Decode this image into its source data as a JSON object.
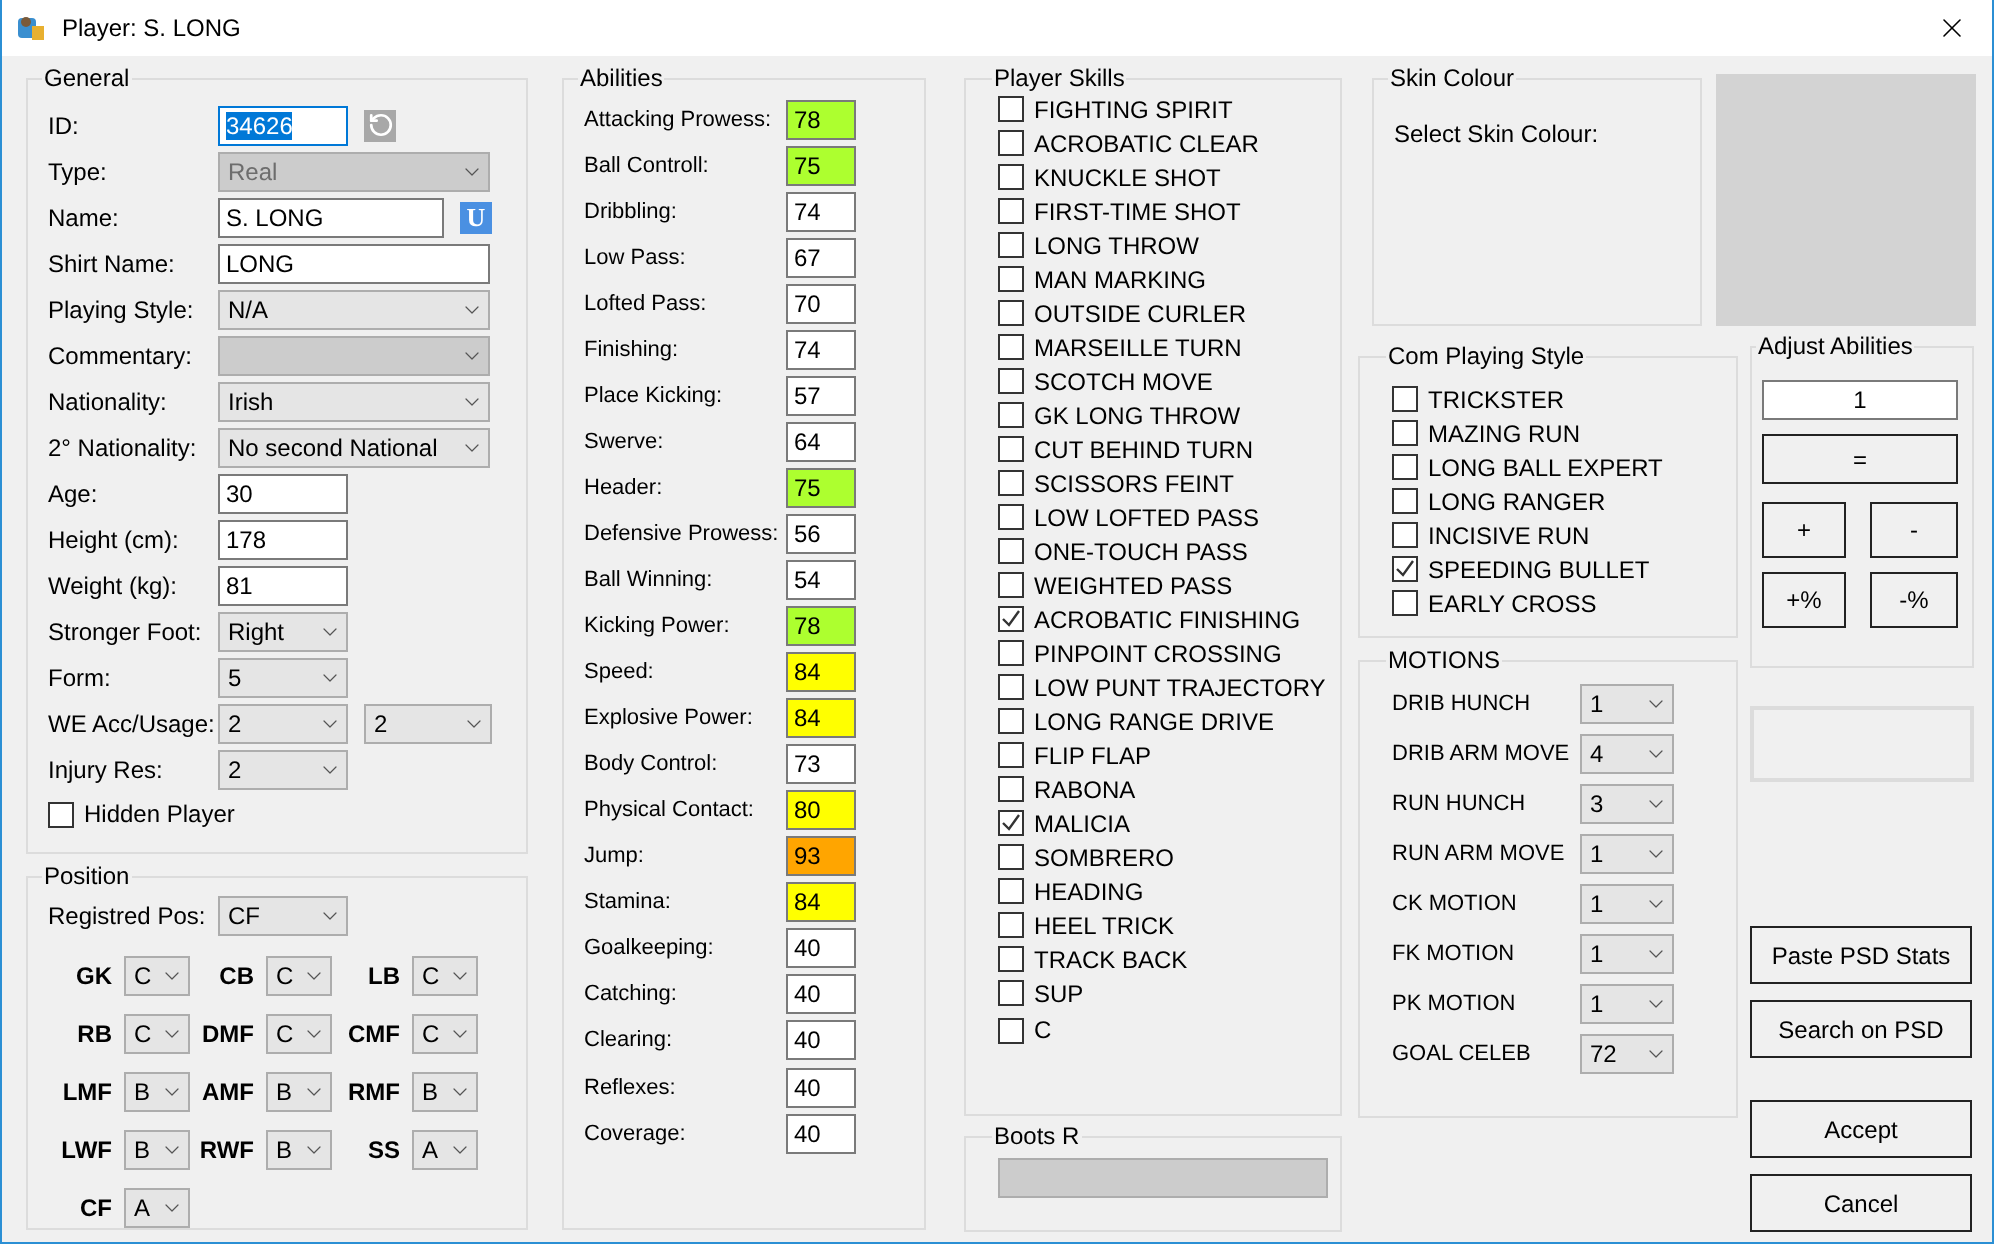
{
  "window": {
    "title": "Player: S. LONG"
  },
  "general": {
    "title": "General",
    "fields": [
      {
        "label": "ID:",
        "kind": "id_text",
        "value": "34626",
        "highlighted": true
      },
      {
        "label": "Type:",
        "kind": "combo",
        "value": "Real",
        "disabled": true
      },
      {
        "label": "Name:",
        "kind": "name_text",
        "value": "S. LONG",
        "button": "U"
      },
      {
        "label": "Shirt Name:",
        "kind": "text",
        "value": "LONG"
      },
      {
        "label": "Playing Style:",
        "kind": "combo",
        "value": "N/A",
        "disabled": false
      },
      {
        "label": "Commentary:",
        "kind": "combo",
        "disabled": true
      },
      {
        "label": "Nationality:",
        "kind": "combo",
        "value": "Irish",
        "disabled": false
      },
      {
        "label": "2° Nationality:",
        "kind": "combo",
        "value": "No second National",
        "disabled": false
      },
      {
        "label": "Age:",
        "kind": "short_text",
        "value": "30"
      },
      {
        "label": "Height (cm):",
        "kind": "short_text",
        "value": "178"
      },
      {
        "label": "Weight (kg):",
        "kind": "short_text",
        "value": "81"
      },
      {
        "label": "Stronger Foot:",
        "kind": "short_combo",
        "value": "Right"
      },
      {
        "label": "Form:",
        "kind": "short_combo",
        "value": "5"
      },
      {
        "label": "WE Acc/Usage:",
        "kind": "double_combo",
        "values": [
          "2",
          "2"
        ]
      },
      {
        "label": "Injury Res:",
        "kind": "short_combo",
        "value": "2"
      }
    ],
    "hidden_player": {
      "label": "Hidden Player",
      "checked": false
    }
  },
  "position": {
    "title": "Position",
    "registered": {
      "label": "Registred Pos:",
      "value": "CF"
    },
    "grid": [
      {
        "label": "GK",
        "value": "C"
      },
      {
        "label": "CB",
        "value": "C"
      },
      {
        "label": "LB",
        "value": "C"
      },
      {
        "label": "RB",
        "value": "C"
      },
      {
        "label": "DMF",
        "value": "C"
      },
      {
        "label": "CMF",
        "value": "C"
      },
      {
        "label": "LMF",
        "value": "B"
      },
      {
        "label": "AMF",
        "value": "B"
      },
      {
        "label": "RMF",
        "value": "B"
      },
      {
        "label": "LWF",
        "value": "B"
      },
      {
        "label": "RWF",
        "value": "B"
      },
      {
        "label": "SS",
        "value": "A"
      },
      {
        "label": "CF",
        "value": "A"
      }
    ]
  },
  "abilities": {
    "title": "Abilities",
    "rows": [
      {
        "label": "Attacking Prowess:",
        "value": "78",
        "color": "#adff2f"
      },
      {
        "label": "Ball Controll:",
        "value": "75",
        "color": "#adff2f"
      },
      {
        "label": "Dribbling:",
        "value": "74",
        "color": "#ffffff"
      },
      {
        "label": "Low Pass:",
        "value": "67",
        "color": "#ffffff"
      },
      {
        "label": "Lofted Pass:",
        "value": "70",
        "color": "#ffffff"
      },
      {
        "label": "Finishing:",
        "value": "74",
        "color": "#ffffff"
      },
      {
        "label": "Place Kicking:",
        "value": "57",
        "color": "#ffffff"
      },
      {
        "label": "Swerve:",
        "value": "64",
        "color": "#ffffff"
      },
      {
        "label": "Header:",
        "value": "75",
        "color": "#adff2f"
      },
      {
        "label": "Defensive Prowess:",
        "value": "56",
        "color": "#ffffff"
      },
      {
        "label": "Ball Winning:",
        "value": "54",
        "color": "#ffffff"
      },
      {
        "label": "Kicking Power:",
        "value": "78",
        "color": "#adff2f"
      },
      {
        "label": "Speed:",
        "value": "84",
        "color": "#ffff00"
      },
      {
        "label": "Explosive Power:",
        "value": "84",
        "color": "#ffff00"
      },
      {
        "label": "Body Control:",
        "value": "73",
        "color": "#ffffff"
      },
      {
        "label": "Physical Contact:",
        "value": "80",
        "color": "#ffff00"
      },
      {
        "label": "Jump:",
        "value": "93",
        "color": "#ffa500"
      },
      {
        "label": "Stamina:",
        "value": "84",
        "color": "#ffff00"
      },
      {
        "label": "Goalkeeping:",
        "value": "40",
        "color": "#ffffff"
      },
      {
        "label": "Catching:",
        "value": "40",
        "color": "#ffffff"
      },
      {
        "label": "Clearing:",
        "value": "40",
        "color": "#ffffff"
      },
      {
        "label": "Reflexes:",
        "value": "40",
        "color": "#ffffff"
      },
      {
        "label": "Coverage:",
        "value": "40",
        "color": "#ffffff"
      }
    ]
  },
  "skills": {
    "title": "Player Skills",
    "items": [
      {
        "label": "FIGHTING SPIRIT",
        "checked": false
      },
      {
        "label": "ACROBATIC CLEAR",
        "checked": false
      },
      {
        "label": "KNUCKLE SHOT",
        "checked": false
      },
      {
        "label": "FIRST-TIME SHOT",
        "checked": false
      },
      {
        "label": "LONG THROW",
        "checked": false
      },
      {
        "label": "MAN MARKING",
        "checked": false
      },
      {
        "label": "OUTSIDE CURLER",
        "checked": false
      },
      {
        "label": "MARSEILLE TURN",
        "checked": false
      },
      {
        "label": "SCOTCH MOVE",
        "checked": false
      },
      {
        "label": "GK LONG THROW",
        "checked": false
      },
      {
        "label": "CUT BEHIND TURN",
        "checked": false
      },
      {
        "label": "SCISSORS FEINT",
        "checked": false
      },
      {
        "label": "LOW LOFTED PASS",
        "checked": false
      },
      {
        "label": "ONE-TOUCH PASS",
        "checked": false
      },
      {
        "label": "WEIGHTED PASS",
        "checked": false
      },
      {
        "label": "ACROBATIC FINISHING",
        "checked": true
      },
      {
        "label": "PINPOINT CROSSING",
        "checked": false
      },
      {
        "label": "LOW PUNT TRAJECTORY",
        "checked": false
      },
      {
        "label": "LONG RANGE DRIVE",
        "checked": false
      },
      {
        "label": "FLIP FLAP",
        "checked": false
      },
      {
        "label": "RABONA",
        "checked": false
      },
      {
        "label": "MALICIA",
        "checked": true
      },
      {
        "label": "SOMBRERO",
        "checked": false
      },
      {
        "label": "HEADING",
        "checked": false
      },
      {
        "label": "HEEL TRICK",
        "checked": false
      },
      {
        "label": "TRACK BACK",
        "checked": false
      },
      {
        "label": "SUP",
        "checked": false
      },
      {
        "label": "C",
        "checked": false
      }
    ]
  },
  "boots": {
    "title": "Boots R"
  },
  "skin": {
    "title": "Skin Colour",
    "label": "Select Skin Colour:"
  },
  "com_style": {
    "title": "Com Playing Style",
    "items": [
      {
        "label": "TRICKSTER",
        "checked": false
      },
      {
        "label": "MAZING RUN",
        "checked": false
      },
      {
        "label": "LONG BALL EXPERT",
        "checked": false
      },
      {
        "label": "LONG RANGER",
        "checked": false
      },
      {
        "label": "INCISIVE RUN",
        "checked": false
      },
      {
        "label": "SPEEDING BULLET",
        "checked": true
      },
      {
        "label": "EARLY CROSS",
        "checked": false
      }
    ]
  },
  "motions": {
    "title": "MOTIONS",
    "rows": [
      {
        "label": "DRIB HUNCH",
        "value": "1"
      },
      {
        "label": "DRIB ARM MOVE",
        "value": "4"
      },
      {
        "label": "RUN HUNCH",
        "value": "3"
      },
      {
        "label": "RUN ARM MOVE",
        "value": "1"
      },
      {
        "label": "CK MOTION",
        "value": "1"
      },
      {
        "label": "FK MOTION",
        "value": "1"
      },
      {
        "label": "PK MOTION",
        "value": "1"
      },
      {
        "label": "GOAL CELEB",
        "value": "72"
      }
    ]
  },
  "adjust": {
    "title": "Adjust Abilities",
    "value": "1",
    "equals": "=",
    "buttons": [
      "+",
      "-",
      "+%",
      "-%"
    ]
  },
  "buttons": [
    {
      "label": "Paste PSD Stats"
    },
    {
      "label": "Search on PSD"
    },
    {
      "label": "Accept"
    },
    {
      "label": "Cancel"
    }
  ]
}
